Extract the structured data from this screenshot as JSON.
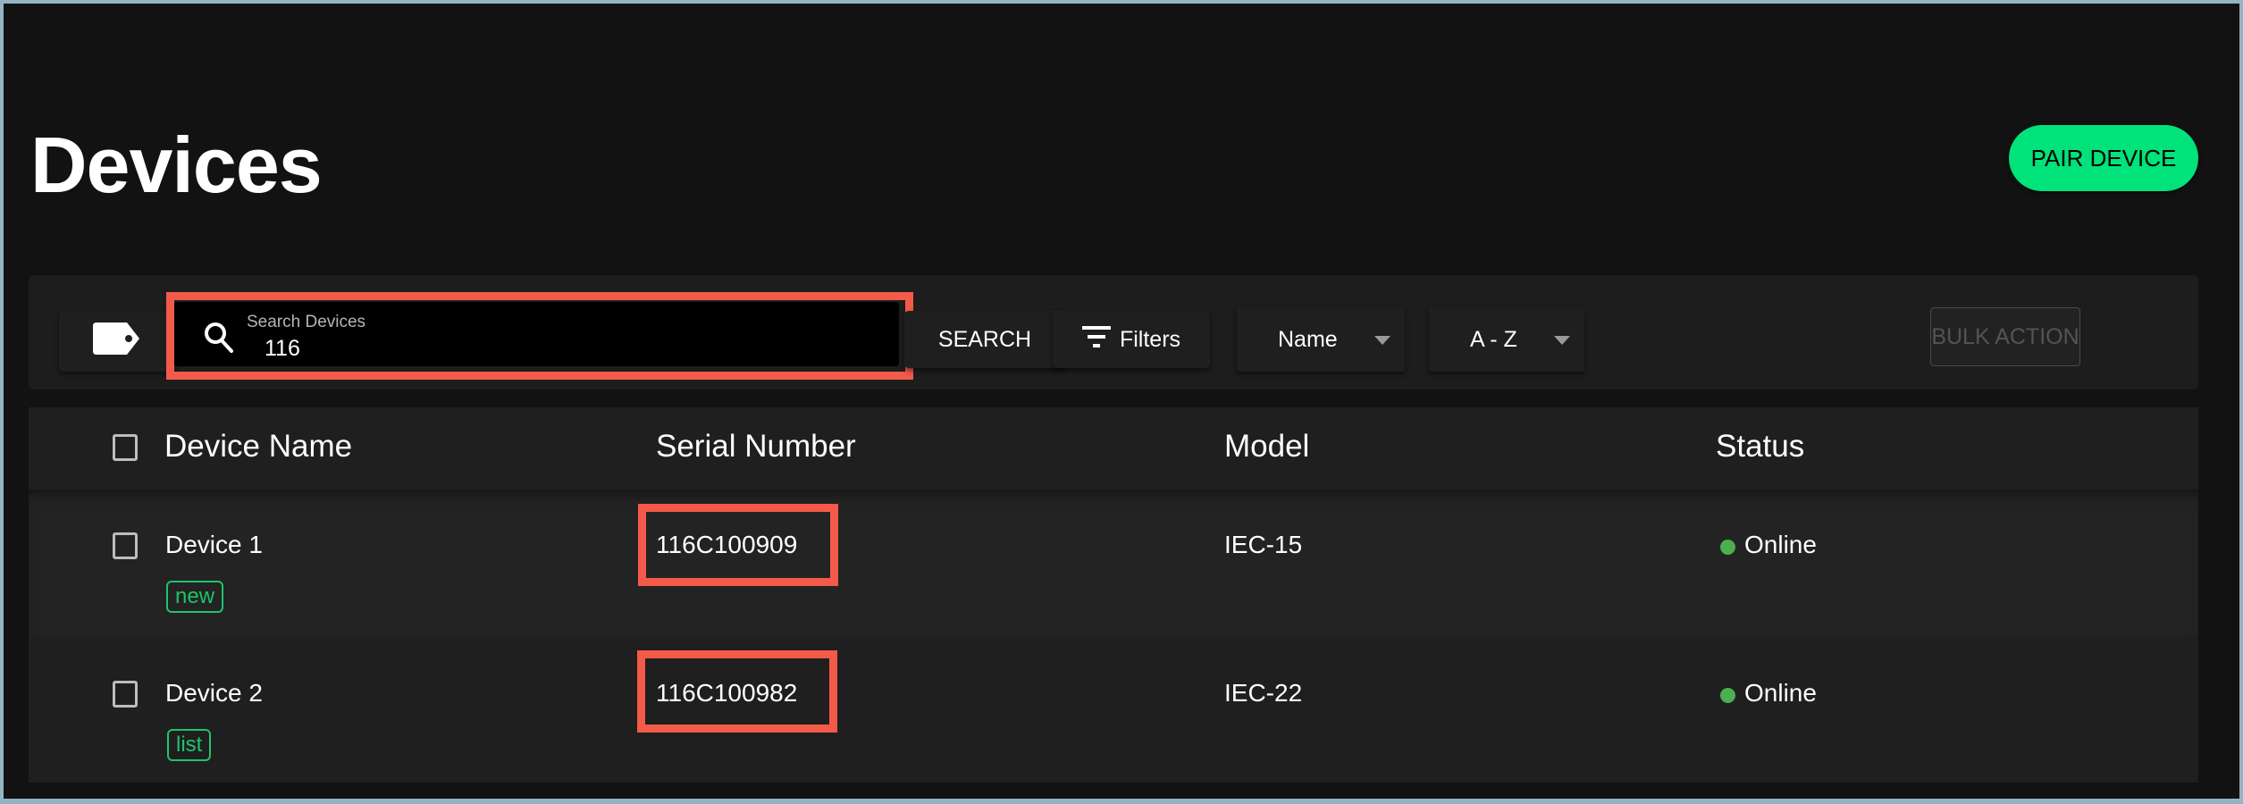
{
  "page": {
    "title": "Devices",
    "pair_button": "PAIR DEVICE"
  },
  "colors": {
    "accent": "#00e37a",
    "status_online": "#4caf50",
    "highlight": "#f45a4a",
    "chip": "#1ec46a"
  },
  "toolbar": {
    "tag_icon": "tag-icon",
    "search": {
      "icon": "search-icon",
      "label": "Search Devices",
      "value": "116"
    },
    "search_button": "SEARCH",
    "filters_button": "Filters",
    "filters_icon": "filter-list-icon",
    "sort_field": "Name",
    "sort_order": "A - Z",
    "bulk_action": "BULK ACTION"
  },
  "table": {
    "columns": [
      "Device Name",
      "Serial Number",
      "Model",
      "Status"
    ],
    "rows": [
      {
        "name": "Device 1",
        "tag": "new",
        "serial": "116C100909",
        "model": "IEC-15",
        "status": "Online"
      },
      {
        "name": "Device 2",
        "tag": "list",
        "serial": "116C100982",
        "model": "IEC-22",
        "status": "Online"
      }
    ]
  }
}
